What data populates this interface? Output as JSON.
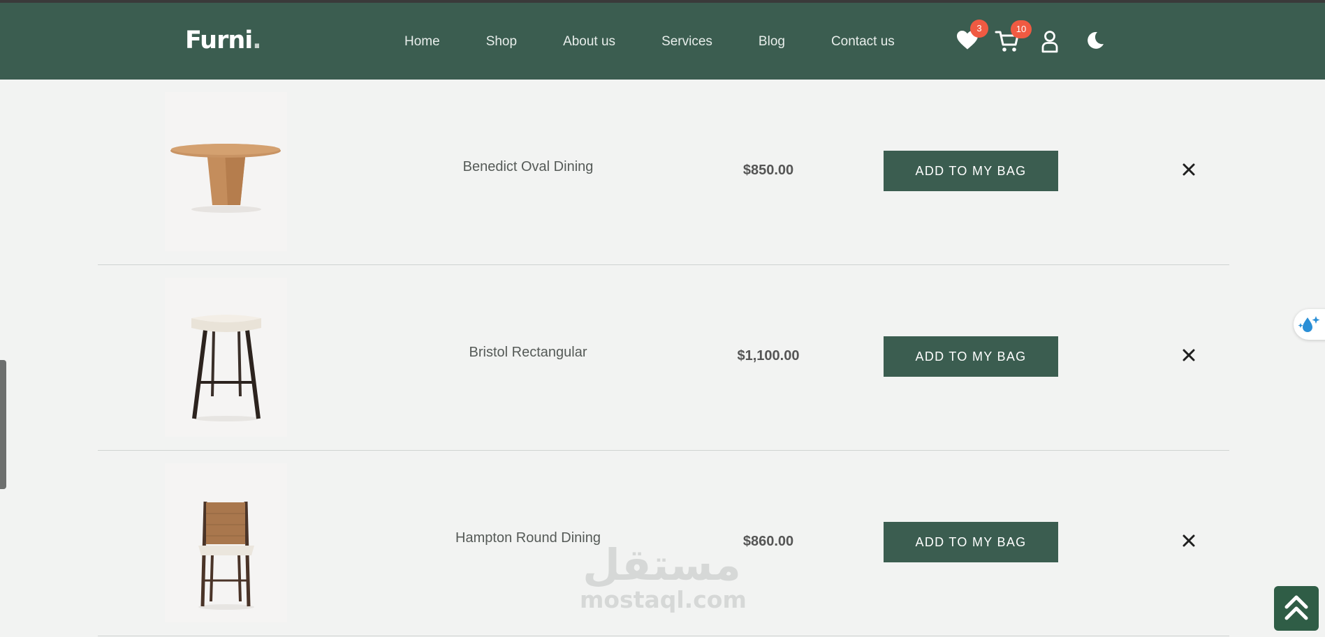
{
  "brand": {
    "name": "Furni",
    "dot": "."
  },
  "nav": {
    "links": [
      "Home",
      "Shop",
      "About us",
      "Services",
      "Blog",
      "Contact us"
    ]
  },
  "header_icons": {
    "wishlist_icon": "heart-icon",
    "wishlist_count": "3",
    "cart_icon": "cart-icon",
    "cart_count": "10",
    "account_icon": "user-icon",
    "theme_icon": "moon-icon"
  },
  "wishlist": {
    "add_label": "ADD TO MY BAG",
    "remove_icon": "close-icon",
    "items": [
      {
        "name": "Benedict Oval Dining",
        "price": "$850.00",
        "image": "oval-table"
      },
      {
        "name": "Bristol Rectangular",
        "price": "$1,100.00",
        "image": "bar-stool"
      },
      {
        "name": "Hampton Round Dining",
        "price": "$860.00",
        "image": "dining-chair"
      }
    ]
  },
  "watermark": {
    "arabic": "مستقل",
    "latin": "mostaql.com"
  },
  "colors": {
    "primary": "#3b5d50",
    "badge": "#f05a42",
    "background": "#f2f3f2"
  }
}
